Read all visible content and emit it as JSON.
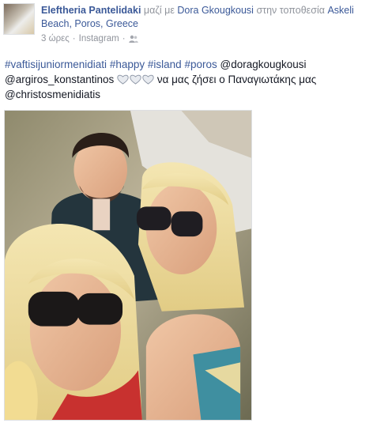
{
  "post": {
    "author": "Eleftheria Pantelidaki",
    "with_word": "μαζί με",
    "tagged_person": "Dora Gkougkousi",
    "location_word": "στην τοποθεσία",
    "location": "Askeli Beach, Poros, Greece",
    "time": "3 ώρες",
    "separator": "·",
    "source": "Instagram",
    "privacy_icon": "friends-icon"
  },
  "body": {
    "hashtags": [
      "#vaftisijuniormenidiati",
      "#happy",
      "#island",
      "#poros"
    ],
    "mention_1": "@doragkougkousi",
    "mention_2": "@argiros_konstantinos",
    "text": "να μας ζήσει ο Παναγιωτάκης μας",
    "mention_3": "@christosmenidiatis",
    "hearts_count": 3
  },
  "colors": {
    "link": "#3b5998",
    "muted": "#90949c",
    "text": "#141823"
  }
}
